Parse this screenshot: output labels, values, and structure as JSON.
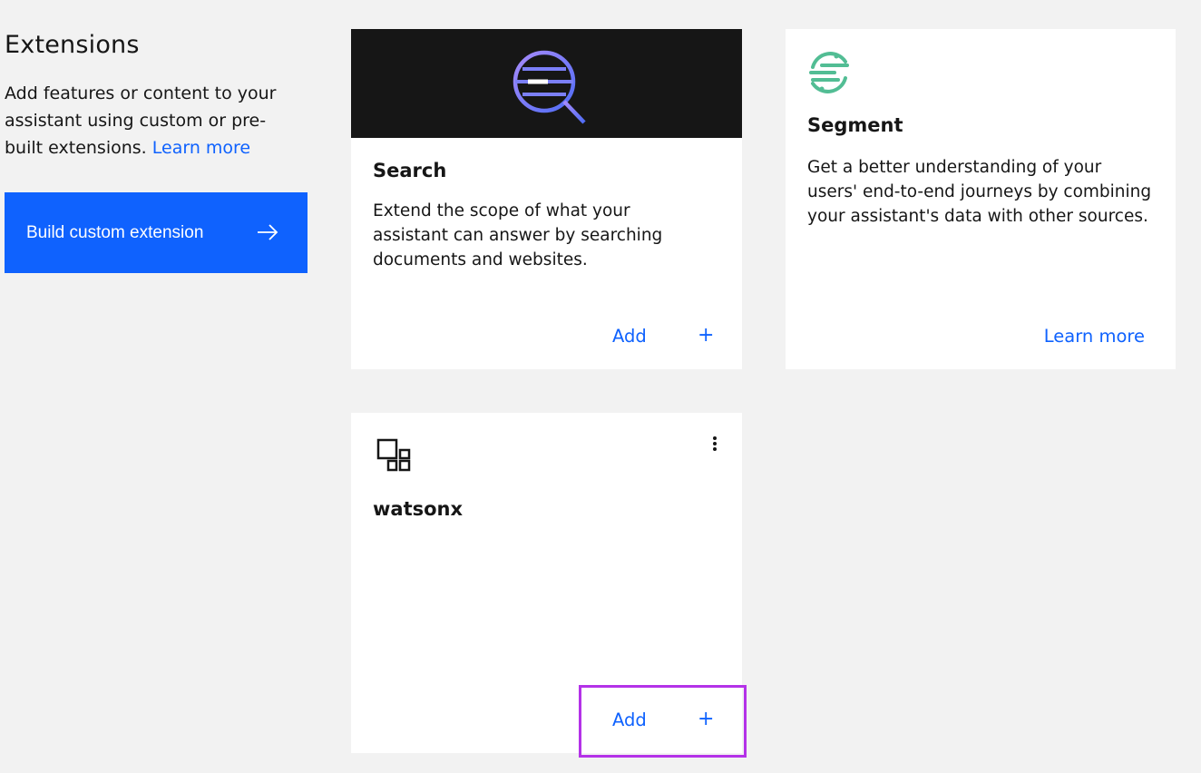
{
  "page": {
    "title": "Extensions",
    "intro_text": "Add features or content to your assistant using custom or pre-built extensions.",
    "intro_link": "Learn more"
  },
  "build_button": {
    "label": "Build custom extension",
    "icon": "arrow-right-icon"
  },
  "cards": [
    {
      "title": "Search",
      "description": "Extend the scope of what your assistant can answer by searching documents and websites.",
      "action_label": "Add",
      "action_icon": "+"
    },
    {
      "title": "Segment",
      "description": "Get a better understanding of your users' end-to-end journeys by combining your assistant's data with other sources.",
      "action_label": "Learn more"
    },
    {
      "title": "watsonx",
      "action_label": "Add",
      "action_icon": "+"
    }
  ],
  "colors": {
    "accent": "#0f62fe",
    "background": "#f2f2f2",
    "banner": "#161616",
    "segment_green": "#52bd94",
    "highlight": "#b432e8"
  }
}
